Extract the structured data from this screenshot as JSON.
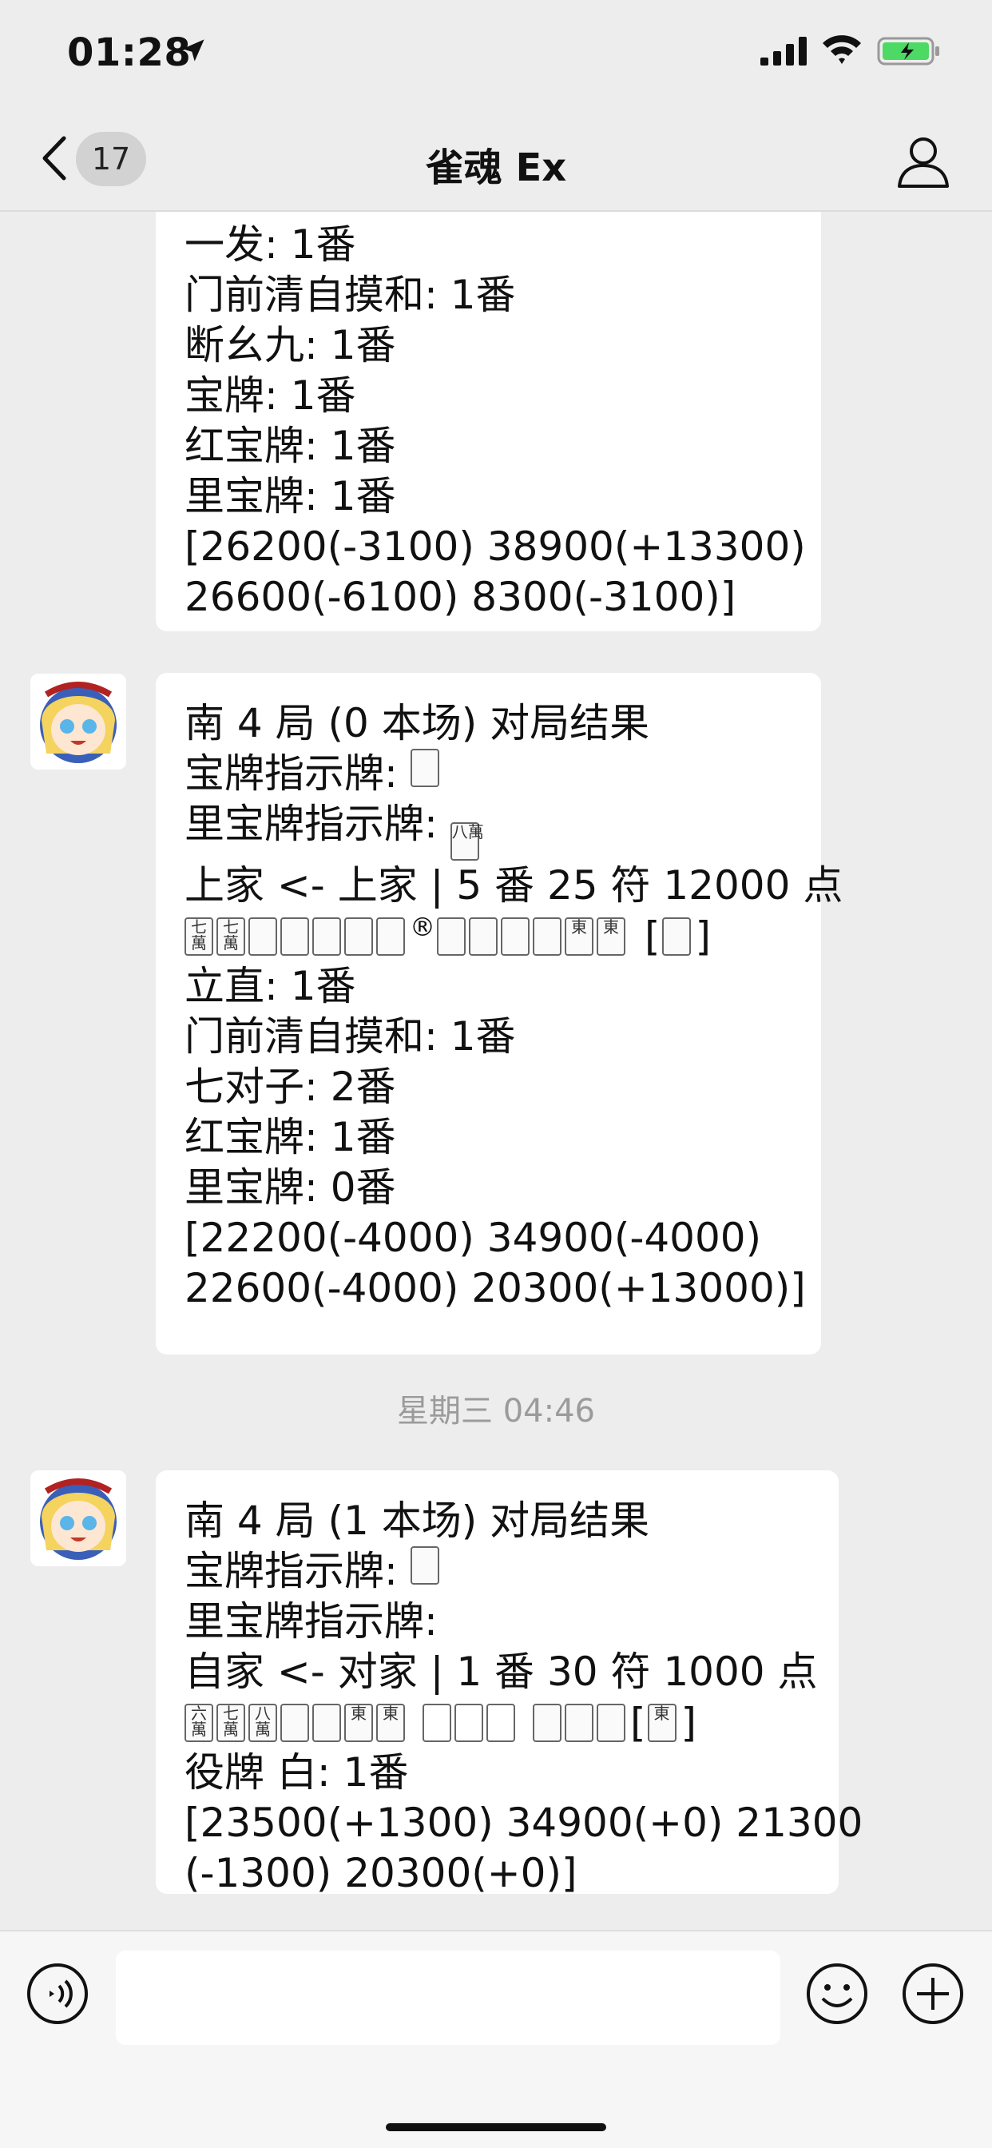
{
  "status": {
    "time": "01:28"
  },
  "nav": {
    "unread_count": "17",
    "title": "雀魂 Ex"
  },
  "messages": [
    {
      "lines": [
        "一发: 1番",
        "门前清自摸和: 1番",
        "断幺九: 1番",
        "宝牌: 1番",
        "红宝牌: 1番",
        "里宝牌: 1番",
        "[26200(-3100) 38900(+13300)",
        "26600(-6100) 8300(-3100)]"
      ]
    },
    {
      "header": [
        "南 4 局 (0 本场) 对局结果",
        "宝牌指示牌:",
        "里宝牌指示牌:",
        "上家 <- 上家 | 5 番 25 符 12000 点"
      ],
      "dora_tile": "",
      "ura_tile": "八萬",
      "hand_tiles": [
        "七萬",
        "七萬",
        "",
        "",
        "",
        "",
        ""
      ],
      "riichi_mark": "®",
      "hand_tiles_2": [
        "",
        "",
        "",
        "",
        "東",
        "東"
      ],
      "win_tile": "",
      "yaku": [
        "立直: 1番",
        "门前清自摸和: 1番",
        "七对子: 2番",
        "红宝牌: 1番",
        "里宝牌: 0番",
        "[22200(-4000) 34900(-4000)",
        "22600(-4000) 20300(+13000)]"
      ]
    },
    {
      "timestamp": "星期三 04:46"
    },
    {
      "header": [
        "南 4 局 (1 本场) 对局结果",
        "宝牌指示牌:",
        "里宝牌指示牌:",
        "自家 <- 对家 | 1 番 30 符 1000 点"
      ],
      "dora_tile": "",
      "hand_tiles": [
        "六萬",
        "七萬",
        "八萬",
        "",
        "",
        "東",
        "東"
      ],
      "meld_1": [
        "",
        "",
        ""
      ],
      "meld_2": [
        "",
        "",
        ""
      ],
      "win_tile": "東",
      "yaku": [
        "役牌 白: 1番",
        "[23500(+1300) 34900(+0) 21300",
        "(-1300) 20300(+0)]"
      ]
    }
  ],
  "colors": {
    "background": "#ededed",
    "bubble": "#ffffff",
    "timestamp": "#9b9b9b"
  },
  "icons": [
    "location-arrow-icon",
    "signal-icon",
    "wifi-icon",
    "battery-icon",
    "back-chevron-icon",
    "profile-icon",
    "voice-icon",
    "emoji-icon",
    "plus-icon"
  ]
}
